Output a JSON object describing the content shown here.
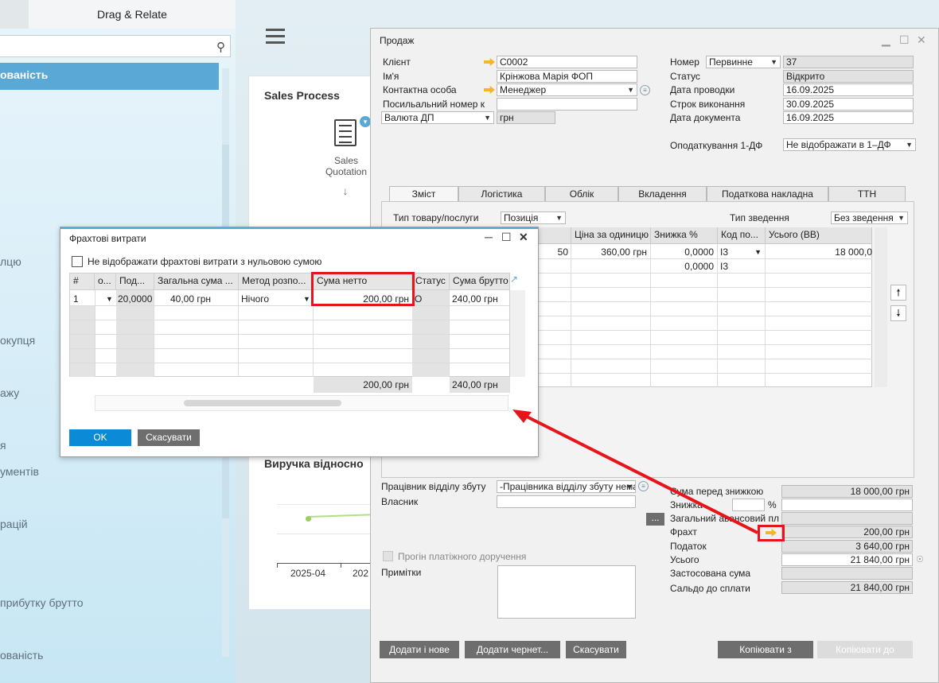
{
  "left": {
    "tab_label": "Drag & Relate",
    "selected_label": "ованість",
    "items": [
      "лцю",
      "окупця",
      "ажу",
      "я",
      "ументів",
      "рацій",
      "прибутку брутто",
      "ованість"
    ]
  },
  "dashboard": {
    "sales_title": "Sales Process",
    "quotation_label": "Sales\nQuotation",
    "revenue_title": "Виручка відносно",
    "x_labels": [
      "2025-04",
      "202"
    ]
  },
  "window": {
    "title": "Продаж",
    "labels": {
      "client": "Клієнт",
      "name": "Ім'я",
      "contact": "Контактна особа",
      "ref": "Посильальний номер к",
      "number": "Номер",
      "status": "Статус",
      "posting_date": "Дата проводки",
      "due_date": "Строк виконання",
      "doc_date": "Дата документа",
      "tax": "Оподаткування 1-ДФ"
    },
    "values": {
      "client": "C0002",
      "name": "Крінжова Марія ФОП",
      "contact": "Менеджер",
      "ref": "",
      "currency_type": "Валюта ДП",
      "currency": "грн",
      "series": "Первинне",
      "number": "37",
      "status": "Відкрито",
      "posting_date": "16.09.2025",
      "due_date": "30.09.2025",
      "doc_date": "16.09.2025",
      "tax": "Не відображати в 1–ДФ"
    },
    "tabs": [
      "Зміст",
      "Логістика",
      "Облік",
      "Вкладення",
      "Податкова накладна",
      "ТТН"
    ],
    "content": {
      "item_type_label": "Тип товару/послуги",
      "item_type_value": "Позиція",
      "summary_label": "Тип зведення",
      "summary_value": "Без зведення",
      "columns": [
        "Ціна за одиницю",
        "Знижка %",
        "Код по...",
        "Усього (ВВ)"
      ],
      "rows": [
        {
          "qty": "50",
          "price": "360,00 грн",
          "discount": "0,0000",
          "code": "I3",
          "total": "18 000,0"
        },
        {
          "qty": "",
          "price": "",
          "discount": "0,0000",
          "code": "I3",
          "total": ""
        }
      ]
    },
    "footer": {
      "employee_label": "Працівник відділу збуту",
      "employee_value": "-Працівника відділу збуту немає-",
      "owner_label": "Власник",
      "owner_value": "",
      "payment_label": "Прогін платіжного доручення",
      "notes_label": "Примітки",
      "ellipsis": "...",
      "totals": [
        {
          "label": "Сума перед знижкою",
          "value": "18 000,00 грн"
        },
        {
          "label": "Знижка",
          "value": ""
        },
        {
          "label": "Загальний авансовий пл",
          "value": ""
        },
        {
          "label": "Фрахт",
          "value": "200,00 грн"
        },
        {
          "label": "Податок",
          "value": "3 640,00 грн"
        },
        {
          "label": "Усього",
          "value": "21 840,00 грн"
        },
        {
          "label": "Застосована сума",
          "value": ""
        },
        {
          "label": "Сальдо до сплати",
          "value": "21 840,00 грн"
        }
      ],
      "percent": "%"
    },
    "buttons": {
      "add_new": "Додати і нове",
      "add_draft": "Додати чернет...",
      "cancel": "Скасувати",
      "copy_from": "Копіювати з",
      "copy_to": "Копіювати до"
    }
  },
  "freight": {
    "title": "Фрахтові витрати",
    "checkbox_label": "Не відображати фрахтові витрати з нульовою сумою",
    "columns": [
      "#",
      "о...",
      "Под...",
      "Загальна сума ...",
      "Метод розпо...",
      "Сума нетто",
      "Статус",
      "Сума брутто"
    ],
    "row": {
      "num": "1",
      "tax": "20,0000",
      "total": "40,00 грн",
      "method": "Нічого",
      "net": "200,00 грн",
      "status": "O",
      "gross": "240,00 грн"
    },
    "sum_net": "200,00 грн",
    "sum_gross": "240,00 грн",
    "ok": "OK",
    "cancel": "Скасувати"
  },
  "colors": {
    "accent": "#5aa8d6",
    "highlight": "#e8141c",
    "arrow": "#f6b42a"
  }
}
